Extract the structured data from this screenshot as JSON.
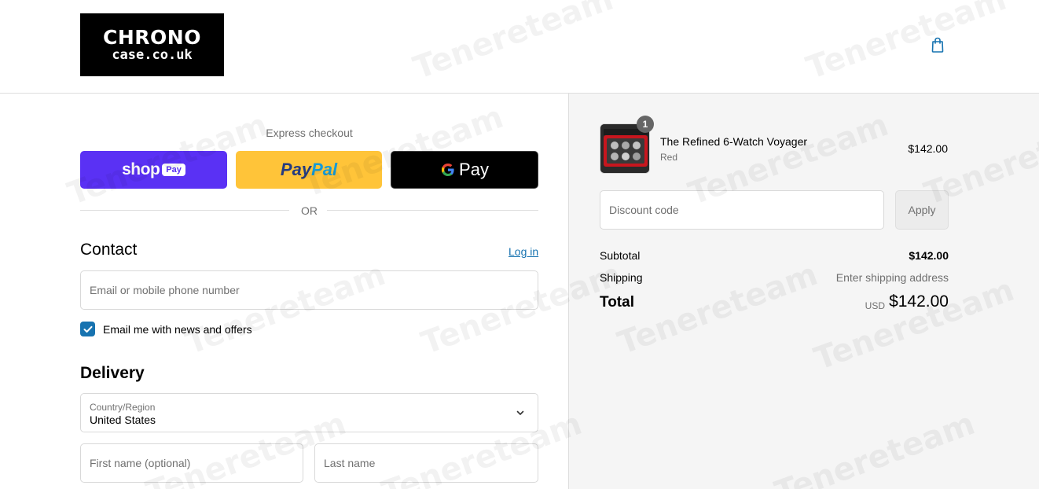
{
  "brand": {
    "logo_line1": "CHRONO",
    "logo_line2": "case.co.uk"
  },
  "header": {
    "cart_icon": "shopping-bag-icon",
    "accent_color": "#1773b0"
  },
  "express_checkout": {
    "label": "Express checkout",
    "shop_pay": {
      "word": "shop",
      "pill": "Pay",
      "color": "#5a31f4"
    },
    "paypal": {
      "part1": "Pay",
      "part2": "Pal",
      "color": "#ffc439"
    },
    "gpay": {
      "g": "G",
      "label": "Pay",
      "color": "#000000"
    },
    "divider_text": "OR"
  },
  "contact": {
    "heading": "Contact",
    "login_link": "Log in",
    "email_placeholder": "Email or mobile phone number",
    "newsletter_label": "Email me with news and offers",
    "newsletter_checked": true
  },
  "delivery": {
    "heading": "Delivery",
    "country_label": "Country/Region",
    "country_value": "United States",
    "first_name_placeholder": "First name (optional)",
    "last_name_placeholder": "Last name"
  },
  "order_summary": {
    "item": {
      "name": "The Refined 6-Watch Voyager",
      "variant": "Red",
      "price": "$142.00",
      "quantity": "1"
    },
    "discount_placeholder": "Discount code",
    "apply_label": "Apply",
    "subtotal_label": "Subtotal",
    "subtotal_value": "$142.00",
    "shipping_label": "Shipping",
    "shipping_value": "Enter shipping address",
    "total_label": "Total",
    "total_currency": "USD",
    "total_value": "$142.00"
  },
  "watermark": "Tenereteam"
}
